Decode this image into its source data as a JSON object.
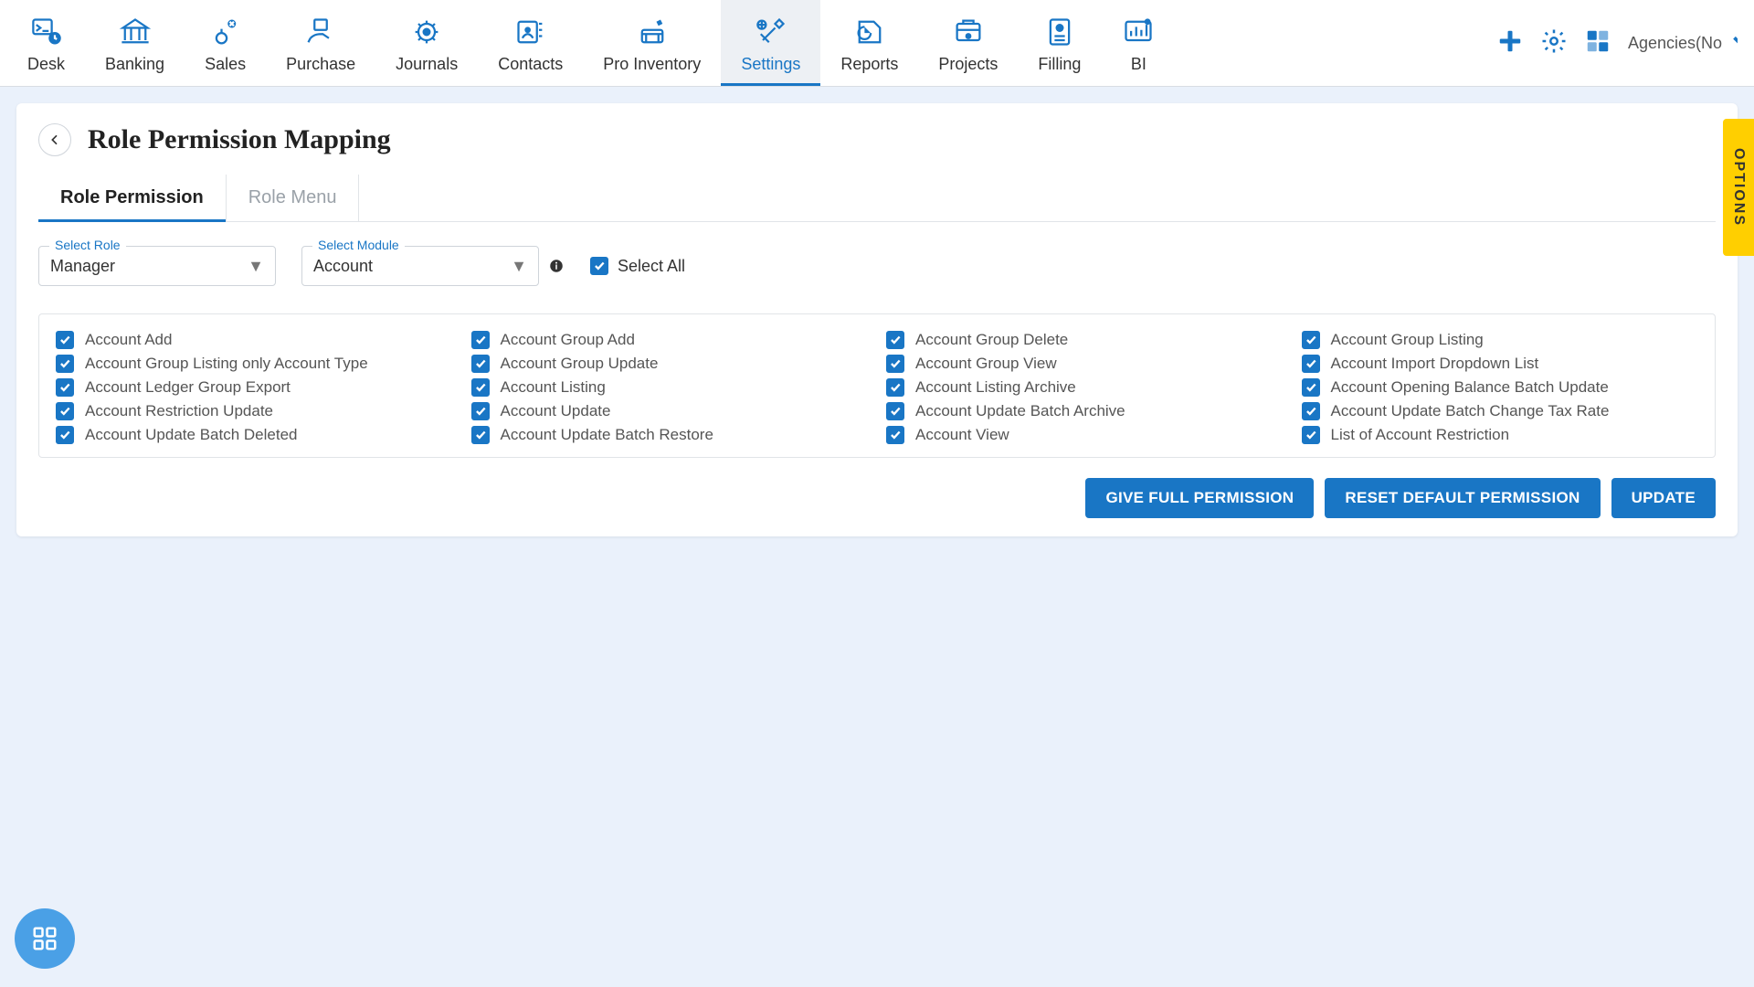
{
  "nav": {
    "items": [
      {
        "key": "desk",
        "label": "Desk"
      },
      {
        "key": "banking",
        "label": "Banking"
      },
      {
        "key": "sales",
        "label": "Sales"
      },
      {
        "key": "purchase",
        "label": "Purchase"
      },
      {
        "key": "journals",
        "label": "Journals"
      },
      {
        "key": "contacts",
        "label": "Contacts"
      },
      {
        "key": "proinventory",
        "label": "Pro Inventory"
      },
      {
        "key": "settings",
        "label": "Settings",
        "active": true
      },
      {
        "key": "reports",
        "label": "Reports"
      },
      {
        "key": "projects",
        "label": "Projects"
      },
      {
        "key": "filling",
        "label": "Filling"
      },
      {
        "key": "bi",
        "label": "BI"
      }
    ]
  },
  "header_right": {
    "org_label": "Agencies(No"
  },
  "page": {
    "title": "Role Permission Mapping"
  },
  "tabs": [
    {
      "label": "Role Permission",
      "active": true
    },
    {
      "label": "Role Menu"
    }
  ],
  "filters": {
    "role_label": "Select Role",
    "role_value": "Manager",
    "module_label": "Select Module",
    "module_value": "Account",
    "select_all_label": "Select All",
    "select_all_checked": true
  },
  "permissions": [
    "Account Add",
    "Account Group Add",
    "Account Group Delete",
    "Account Group Listing",
    "Account Group Listing only Account Type",
    "Account Group Update",
    "Account Group View",
    "Account Import Dropdown List",
    "Account Ledger Group Export",
    "Account Listing",
    "Account Listing Archive",
    "Account Opening Balance Batch Update",
    "Account Restriction Update",
    "Account Update",
    "Account Update Batch Archive",
    "Account Update Batch Change Tax Rate",
    "Account Update Batch Deleted",
    "Account Update Batch Restore",
    "Account View",
    "List of Account Restriction"
  ],
  "actions": {
    "full": "GIVE FULL PERMISSION",
    "reset": "RESET DEFAULT PERMISSION",
    "update": "UPDATE"
  },
  "options_tab": "OPTIONS"
}
